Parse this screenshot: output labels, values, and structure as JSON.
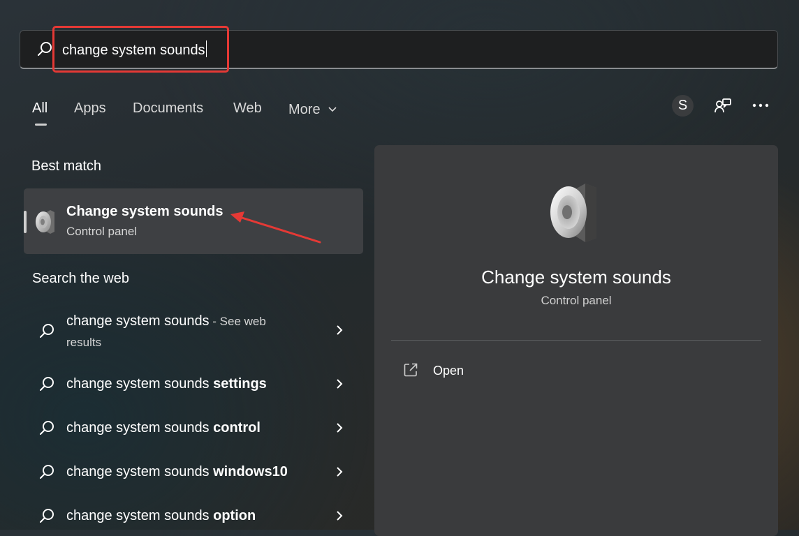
{
  "search": {
    "query": "change system sounds"
  },
  "tabs": [
    {
      "label": "All",
      "active": true
    },
    {
      "label": "Apps"
    },
    {
      "label": "Documents"
    },
    {
      "label": "Web"
    },
    {
      "label": "More"
    }
  ],
  "header_actions": {
    "avatar_initial": "S",
    "feedback_icon": "feedback-hub-icon",
    "more_icon": "ellipsis-icon"
  },
  "best_match": {
    "section_title": "Best match",
    "title": "Change system sounds",
    "subtitle": "Control panel",
    "icon": "speaker-icon"
  },
  "search_web": {
    "section_title": "Search the web",
    "items": [
      {
        "prefix": "change system sounds",
        "suffix": "",
        "see_web_part1": " - See web",
        "see_web_part2": "results"
      },
      {
        "prefix": "change system sounds ",
        "suffix": "settings"
      },
      {
        "prefix": "change system sounds ",
        "suffix": "control"
      },
      {
        "prefix": "change system sounds ",
        "suffix": "windows10"
      },
      {
        "prefix": "change system sounds ",
        "suffix": "option"
      }
    ]
  },
  "preview": {
    "title": "Change system sounds",
    "subtitle": "Control panel",
    "action_open": "Open",
    "action_icon": "open-external-icon"
  },
  "colors": {
    "highlight_red": "#e53935",
    "card_bg": "#3e4043",
    "preview_bg": "#3a3b3d"
  }
}
